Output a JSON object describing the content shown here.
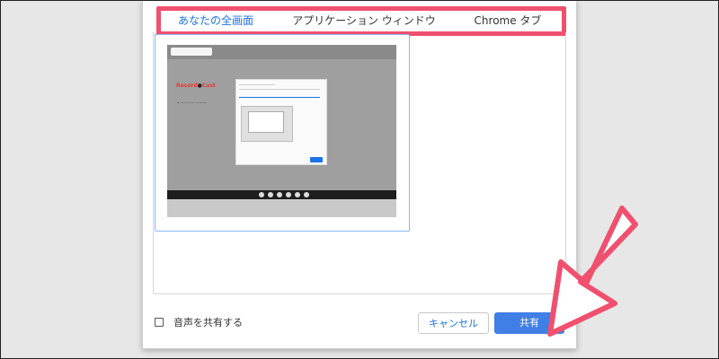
{
  "tabs": [
    {
      "label": "あなたの全画面",
      "active": true
    },
    {
      "label": "アプリケーション ウィンドウ",
      "active": false
    },
    {
      "label": "Chrome タブ",
      "active": false
    }
  ],
  "thumbnail": {
    "brand_prefix": "Record",
    "brand_suffix": "Cast"
  },
  "audio_checkbox": {
    "label": "音声を共有する",
    "checked": false
  },
  "buttons": {
    "cancel": "キャンセル",
    "share": "共有"
  },
  "colors": {
    "accent": "#1a73e8",
    "highlight": "#f0506e",
    "share_button": "#3f7fe6"
  }
}
